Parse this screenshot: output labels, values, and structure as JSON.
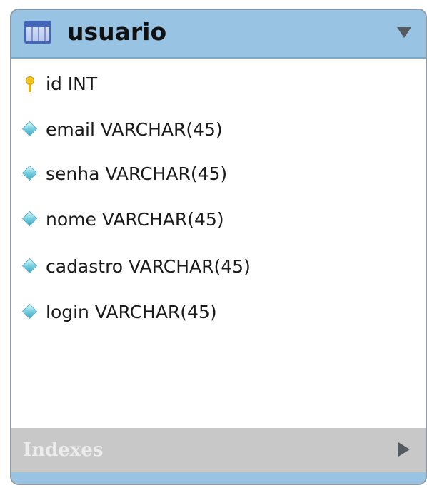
{
  "table": {
    "title": "usuario",
    "header_icon": "table-icon",
    "collapse_icon": "triangle-down-icon"
  },
  "columns": [
    {
      "label": "id INT",
      "icon": "primary-key-icon"
    },
    {
      "label": "email VARCHAR(45)",
      "icon": "column-diamond-icon"
    },
    {
      "label": "senha VARCHAR(45)",
      "icon": "column-diamond-icon"
    },
    {
      "label": "nome VARCHAR(45)",
      "icon": "column-diamond-icon"
    },
    {
      "label": "cadastro VARCHAR(45)",
      "icon": "column-diamond-icon"
    },
    {
      "label": "login VARCHAR(45)",
      "icon": "column-diamond-icon"
    }
  ],
  "indexes": {
    "label": "Indexes",
    "expand_icon": "triangle-right-icon"
  },
  "colors": {
    "header": "#99c3e3",
    "indexes_bar": "#c8c8c8",
    "key": "#f2c21e",
    "column_diamond": "#7fd3e4"
  }
}
